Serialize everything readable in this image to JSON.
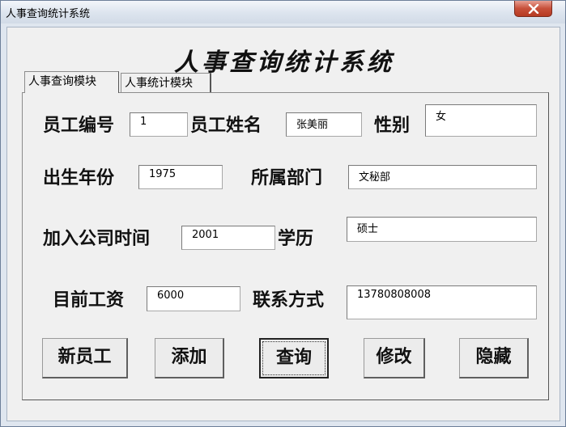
{
  "window": {
    "title": "人事查询统计系统",
    "close_icon": "close-icon"
  },
  "app_title": "人事查询统计系统",
  "tabs": [
    {
      "label": "人事查询模块",
      "active": true
    },
    {
      "label": "人事统计模块",
      "active": false
    }
  ],
  "form": {
    "employee_id": {
      "label": "员工编号",
      "value": "1"
    },
    "employee_name": {
      "label": "员工姓名",
      "value": "张美丽"
    },
    "gender": {
      "label": "性别",
      "value": "女"
    },
    "birth_year": {
      "label": "出生年份",
      "value": "1975"
    },
    "department": {
      "label": "所属部门",
      "value": "文秘部"
    },
    "join_time": {
      "label": "加入公司时间",
      "value": "2001"
    },
    "education": {
      "label": "学历",
      "value": "硕士"
    },
    "salary": {
      "label": "目前工资",
      "value": "6000"
    },
    "contact": {
      "label": "联系方式",
      "value": "13780808008"
    }
  },
  "buttons": {
    "new": "新员工",
    "add": "添加",
    "query": "查询",
    "modify": "修改",
    "hide": "隐藏"
  }
}
